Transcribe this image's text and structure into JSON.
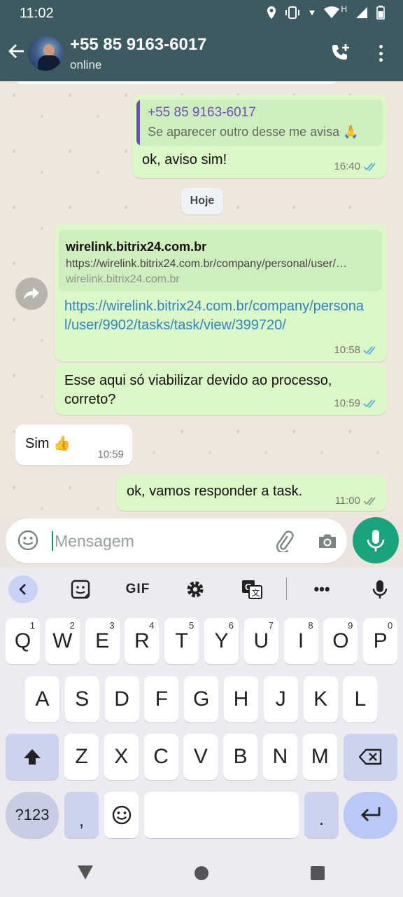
{
  "status_bar": {
    "time": "11:02",
    "network_label": "H"
  },
  "header": {
    "contact_name": "+55 85 9163-6017",
    "contact_status": "online"
  },
  "messages": {
    "quoted_reply": {
      "quote_name": "+55 85 9163-6017",
      "quote_text": "Se aparecer outro desse me avisa 🙏",
      "text": "ok, aviso sim!",
      "time": "16:40"
    },
    "date_chip": "Hoje",
    "link_message": {
      "preview_title": "wirelink.bitrix24.com.br",
      "preview_description": "https://wirelink.bitrix24.com.br/company/personal/user/…",
      "preview_domain": "wirelink.bitrix24.com.br",
      "link": "https://wirelink.bitrix24.com.br/company/personal/user/9902/tasks/task/view/399720/",
      "time": "10:58"
    },
    "question": {
      "text": "Esse aqui só viabilizar devido ao processo, correto?",
      "time": "10:59"
    },
    "reply_in": {
      "text": "Sim 👍",
      "time": "10:59"
    },
    "last_out": {
      "text": "ok, vamos responder a task.",
      "time": "11:00"
    }
  },
  "composer": {
    "placeholder": "Mensagem"
  },
  "keyboard": {
    "toolbar": {
      "gif_label": "GIF",
      "more_label": "•••"
    },
    "row1": [
      {
        "k": "Q",
        "h": "1"
      },
      {
        "k": "W",
        "h": "2"
      },
      {
        "k": "E",
        "h": "3"
      },
      {
        "k": "R",
        "h": "4"
      },
      {
        "k": "T",
        "h": "5"
      },
      {
        "k": "Y",
        "h": "6"
      },
      {
        "k": "U",
        "h": "7"
      },
      {
        "k": "I",
        "h": "8"
      },
      {
        "k": "O",
        "h": "9"
      },
      {
        "k": "P",
        "h": "0"
      }
    ],
    "row2": [
      "A",
      "S",
      "D",
      "F",
      "G",
      "H",
      "J",
      "K",
      "L"
    ],
    "row3": [
      "Z",
      "X",
      "C",
      "V",
      "B",
      "N",
      "M"
    ],
    "symbols_label": "?123",
    "comma_label": ",",
    "period_label": "."
  },
  "colors": {
    "header_bg": "#3e5a61",
    "outgoing_bubble": "#dcf8c6",
    "incoming_bubble": "#ffffff",
    "read_ticks": "#4fb0e6",
    "accent_green": "#1aa37c",
    "link_blue": "#2e86c1"
  },
  "icons": [
    "back-arrow-icon",
    "add-call-icon",
    "more-vert-icon",
    "forward-icon",
    "emoji-icon",
    "attach-icon",
    "camera-icon",
    "mic-icon",
    "sticker-icon",
    "settings-icon",
    "translate-icon",
    "shift-icon",
    "backspace-icon",
    "enter-icon"
  ]
}
